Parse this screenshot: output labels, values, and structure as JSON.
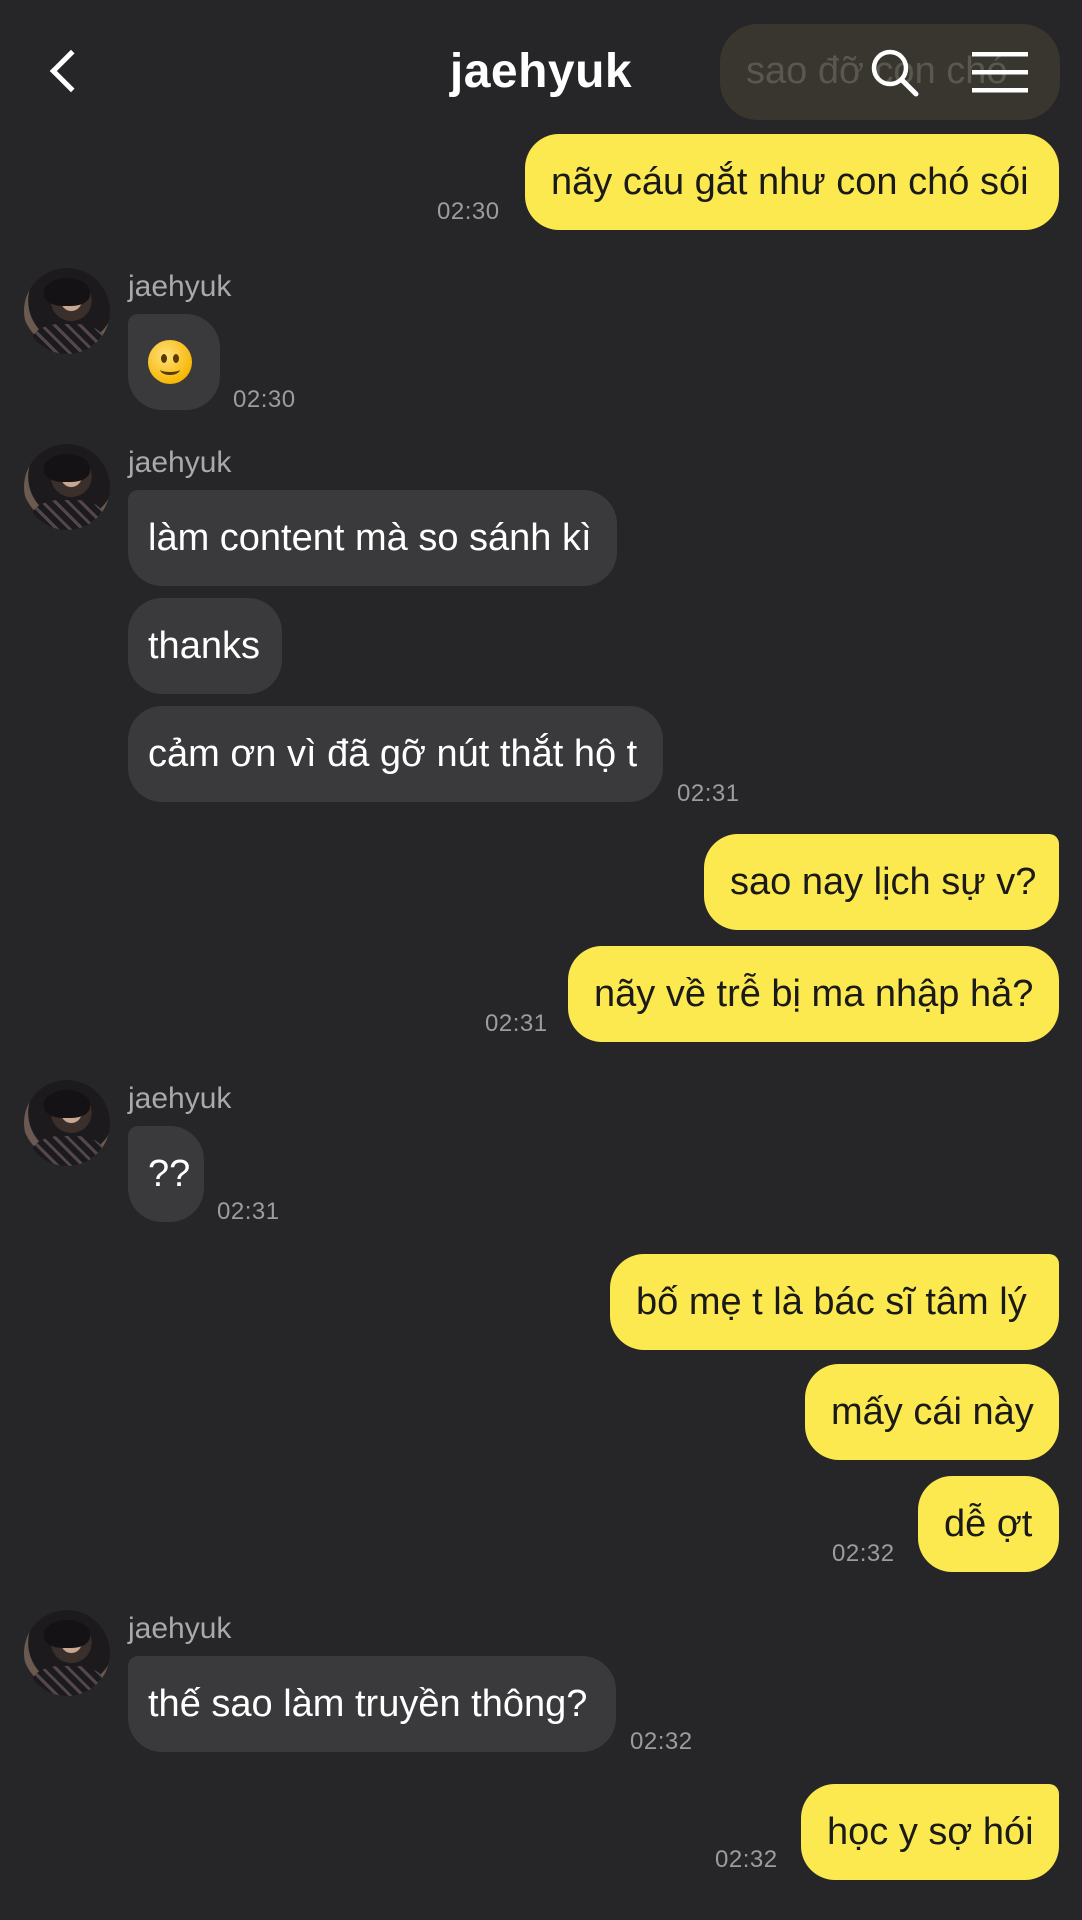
{
  "colors": {
    "background": "#262628",
    "my_bubble": "#fce94f",
    "their_bubble": "#3a3a3c",
    "timestamp": "#9c9c9f"
  },
  "header": {
    "title": "jaehyuk",
    "pinned_preview": "sao đỡ con chó",
    "back_icon": "chevron-left-icon",
    "search_icon": "search-icon",
    "menu_icon": "hamburger-menu-icon"
  },
  "messages": {
    "m1": {
      "text": "nãy cáu gắt như con chó sói",
      "time": "02:30"
    },
    "g1": {
      "sender": "jaehyuk",
      "emoji": "slightly-smiling-face",
      "time": "02:30"
    },
    "g2": {
      "sender": "jaehyuk",
      "lines": [
        "làm content mà so sánh kì",
        "thanks",
        "cảm ơn vì đã gỡ nút thắt hộ t"
      ],
      "time": "02:31"
    },
    "m2": {
      "lines": [
        "sao nay lịch sự v?",
        "nãy về trễ bị ma nhập hả?"
      ],
      "time": "02:31"
    },
    "g3": {
      "sender": "jaehyuk",
      "text": "??",
      "time": "02:31"
    },
    "m3": {
      "lines": [
        "bố mẹ t là bác sĩ tâm lý",
        "mấy cái này",
        "dễ ợt"
      ],
      "time": "02:32"
    },
    "g4": {
      "sender": "jaehyuk",
      "text": "thế sao làm truyền thông?",
      "time": "02:32"
    },
    "m4": {
      "text": "học y sợ hói",
      "time": "02:32"
    }
  }
}
